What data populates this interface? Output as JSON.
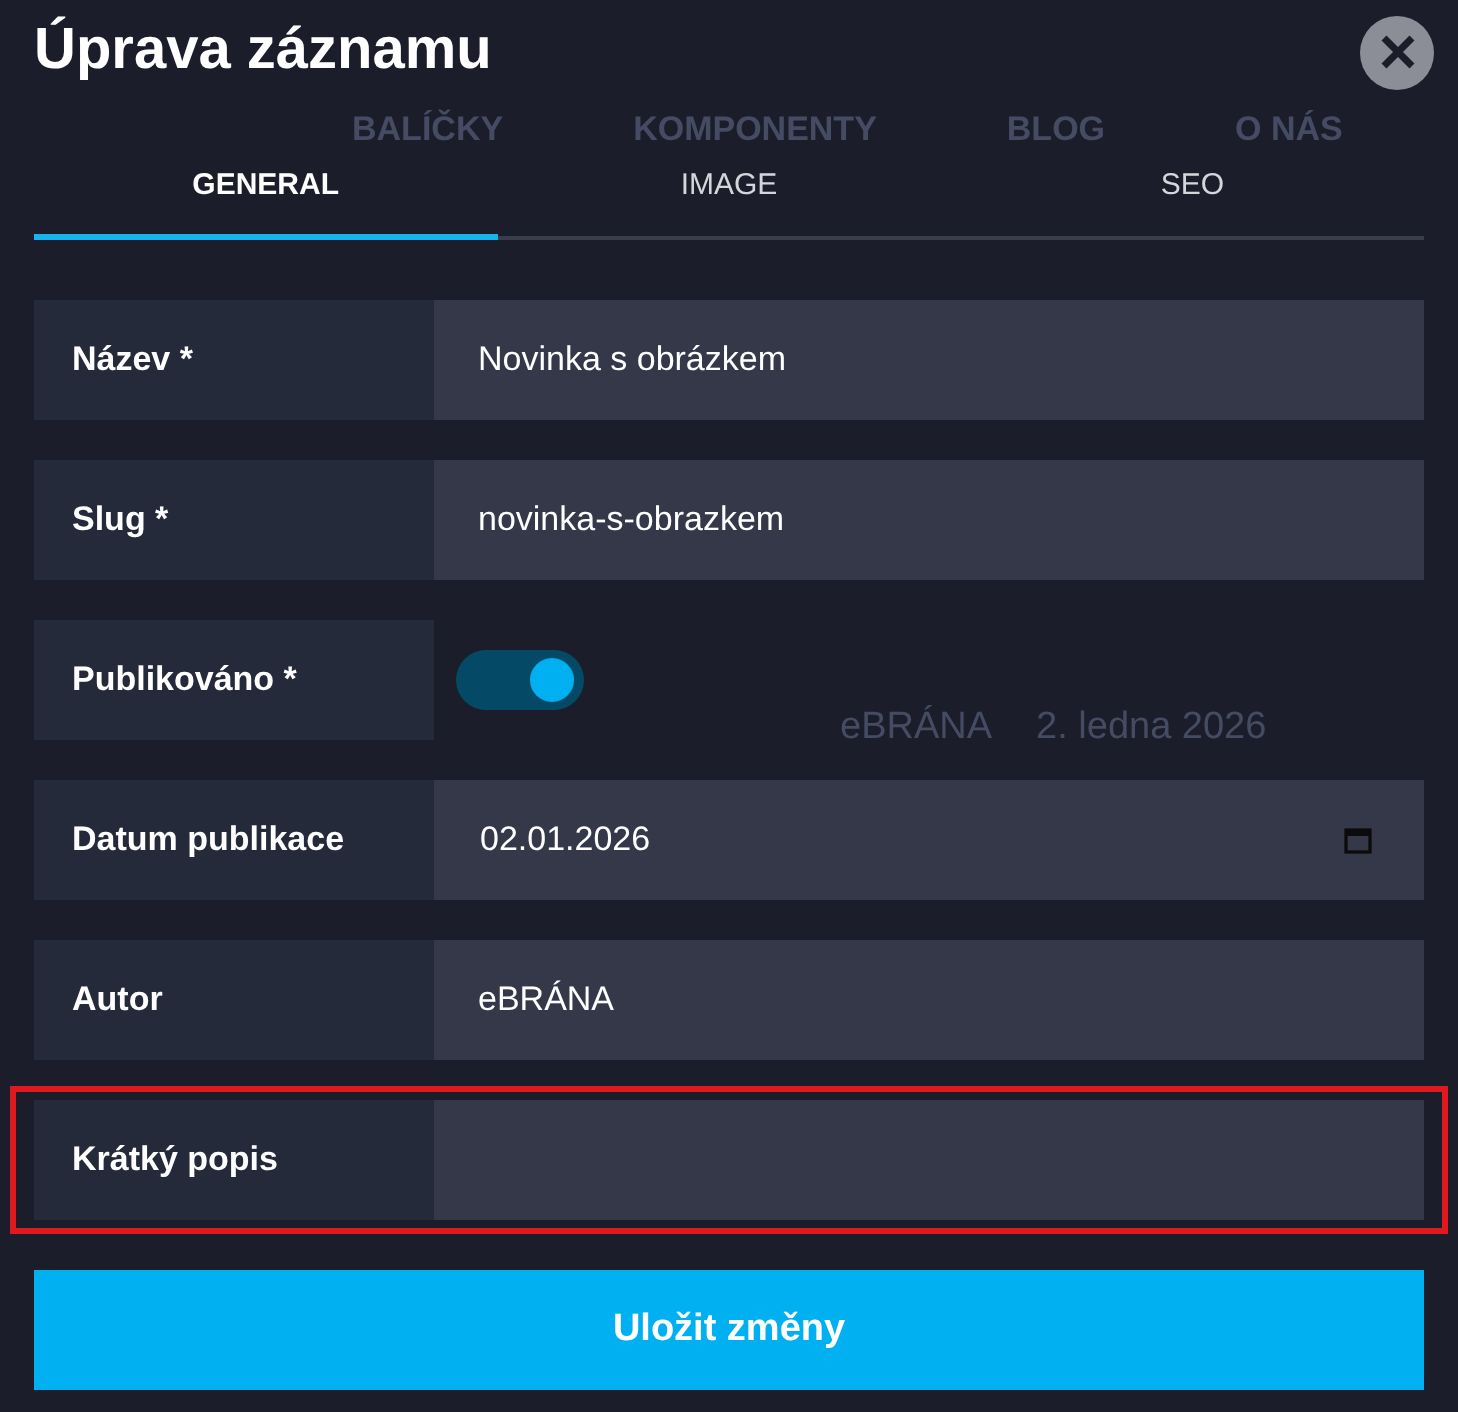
{
  "background_page": {
    "nav": [
      "BALÍČKY",
      "KOMPONENTY",
      "BLOG",
      "O NÁS"
    ],
    "meta": [
      "eBRÁNA",
      "2. ledna 2026"
    ]
  },
  "dialog": {
    "title": "Úprava záznamu"
  },
  "tabs": [
    {
      "label": "GENERAL",
      "selected": true
    },
    {
      "label": "IMAGE",
      "selected": false
    },
    {
      "label": "SEO",
      "selected": false
    }
  ],
  "fields": [
    {
      "kind": "text",
      "label": "Název *",
      "value": "Novinka s obrázkem",
      "highlighted": false
    },
    {
      "kind": "text",
      "label": "Slug *",
      "value": "novinka-s-obrazkem",
      "highlighted": false
    },
    {
      "kind": "toggle",
      "label": "Publikováno *",
      "on": true,
      "highlighted": false
    },
    {
      "kind": "date",
      "label": "Datum publikace",
      "value": "02.01.2026",
      "highlighted": false
    },
    {
      "kind": "text",
      "label": "Autor",
      "value": "eBRÁNA",
      "highlighted": false
    },
    {
      "kind": "text",
      "label": "Krátký popis",
      "highlighted": true
    }
  ],
  "save_button": {
    "label": "Uložit změny"
  }
}
